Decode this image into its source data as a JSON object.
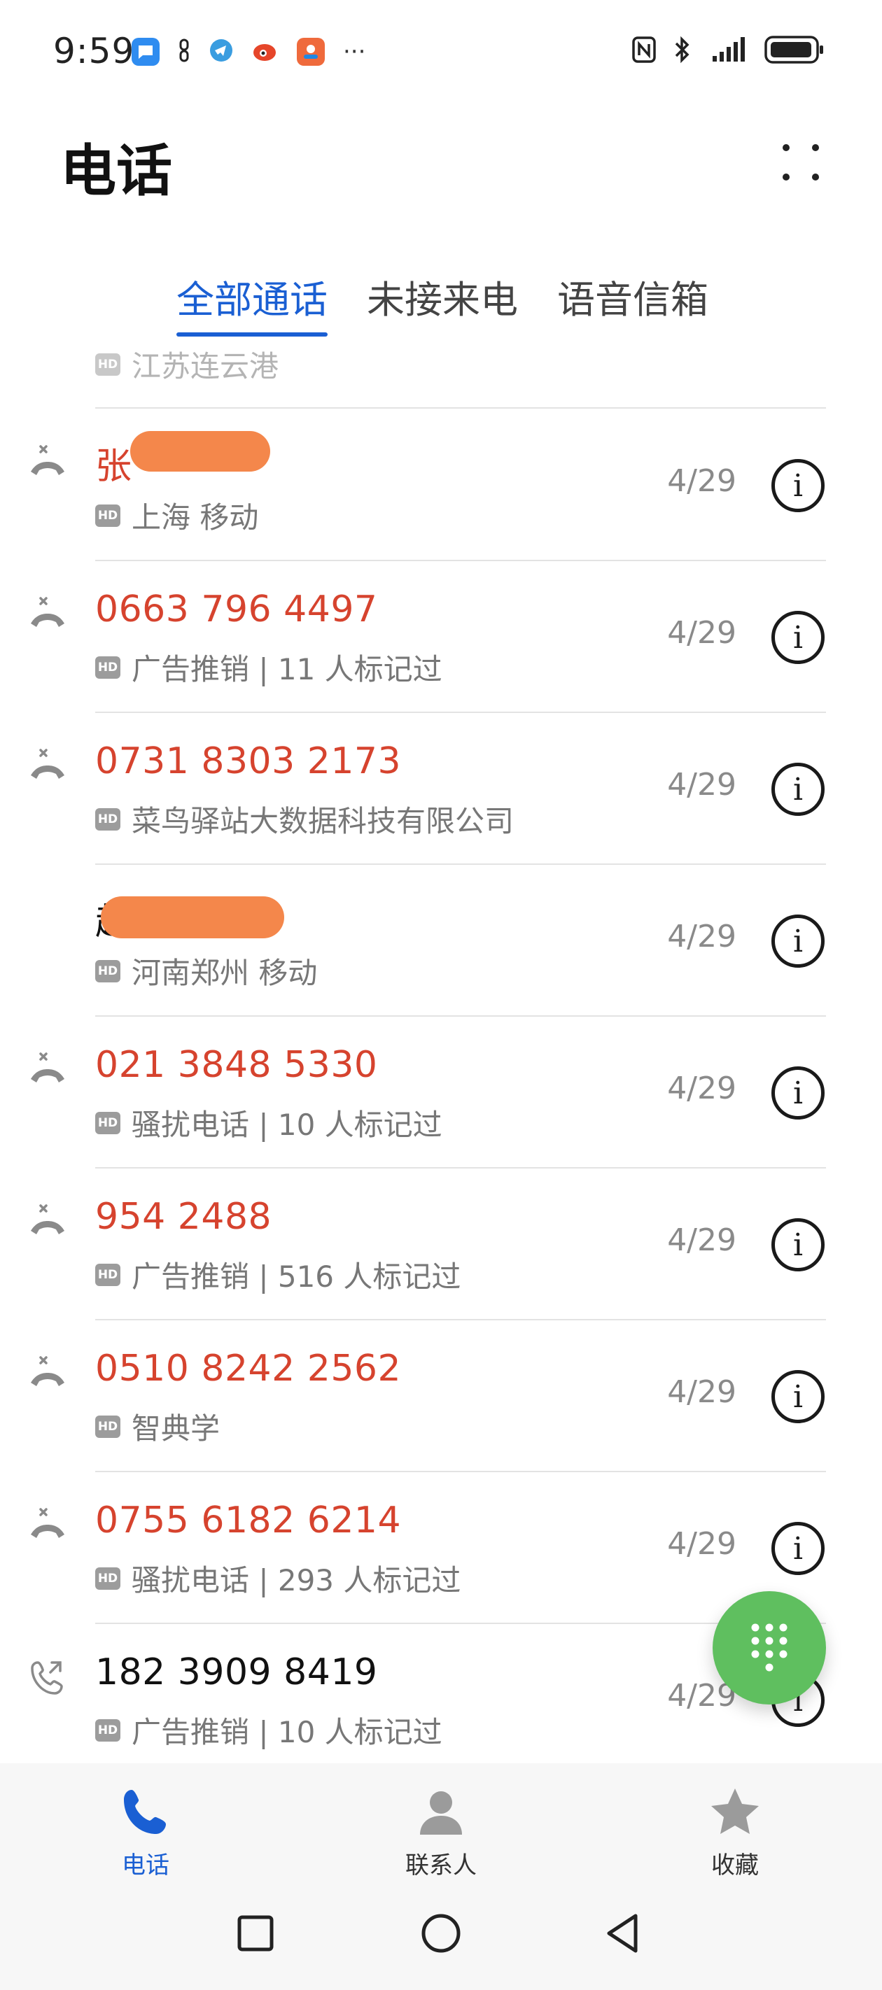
{
  "status_bar": {
    "time": "9:59",
    "left_icons": [
      "message-icon",
      "link-icon",
      "telegram-icon",
      "weibo-icon",
      "app-icon",
      "more-icon"
    ],
    "more_text": "···",
    "right_icons": [
      "nfc-icon",
      "bluetooth-icon",
      "signal-icon",
      "battery-icon"
    ]
  },
  "header": {
    "title": "电话"
  },
  "tabs": [
    {
      "label": "全部通话",
      "active": true
    },
    {
      "label": "未接来电",
      "active": false
    },
    {
      "label": "语音信箱",
      "active": false
    }
  ],
  "partial_row": {
    "desc": "江苏连云港"
  },
  "calls": [
    {
      "name": "张",
      "missed": true,
      "desc": "上海 移动",
      "date": "4/29",
      "type_icon": "missed-call-icon",
      "redacted": true
    },
    {
      "name": "0663 796 4497",
      "missed": true,
      "desc": "广告推销 | 11 人标记过",
      "date": "4/29",
      "type_icon": "missed-call-icon",
      "redacted": false
    },
    {
      "name": "0731 8303 2173",
      "missed": true,
      "desc": "菜鸟驿站大数据科技有限公司",
      "date": "4/29",
      "type_icon": "missed-call-icon",
      "redacted": false
    },
    {
      "name": "赵",
      "missed": false,
      "desc": "河南郑州 移动",
      "date": "4/29",
      "type_icon": "",
      "redacted": true
    },
    {
      "name": "021 3848 5330",
      "missed": true,
      "desc": "骚扰电话 | 10 人标记过",
      "date": "4/29",
      "type_icon": "missed-call-icon",
      "redacted": false
    },
    {
      "name": "954 2488",
      "missed": true,
      "desc": "广告推销 | 516 人标记过",
      "date": "4/29",
      "type_icon": "missed-call-icon",
      "redacted": false
    },
    {
      "name": "0510 8242 2562",
      "missed": true,
      "desc": "智典学",
      "date": "4/29",
      "type_icon": "missed-call-icon",
      "redacted": false
    },
    {
      "name": "0755 6182 6214",
      "missed": true,
      "desc": "骚扰电话 | 293 人标记过",
      "date": "4/29",
      "type_icon": "missed-call-icon",
      "redacted": false
    },
    {
      "name": "182 3909 8419",
      "missed": false,
      "desc": "广告推销 | 10 人标记过",
      "date": "4/29",
      "type_icon": "outgoing-call-icon",
      "redacted": false
    }
  ],
  "hd_label": "HD",
  "info_glyph": "i",
  "bottom_nav": [
    {
      "label": "电话",
      "icon": "phone-icon",
      "active": true
    },
    {
      "label": "联系人",
      "icon": "person-icon",
      "active": false
    },
    {
      "label": "收藏",
      "icon": "star-icon",
      "active": false
    }
  ],
  "colors": {
    "accent": "#1a5fd3",
    "missed": "#d6432e",
    "fab": "#5fbf5f"
  }
}
